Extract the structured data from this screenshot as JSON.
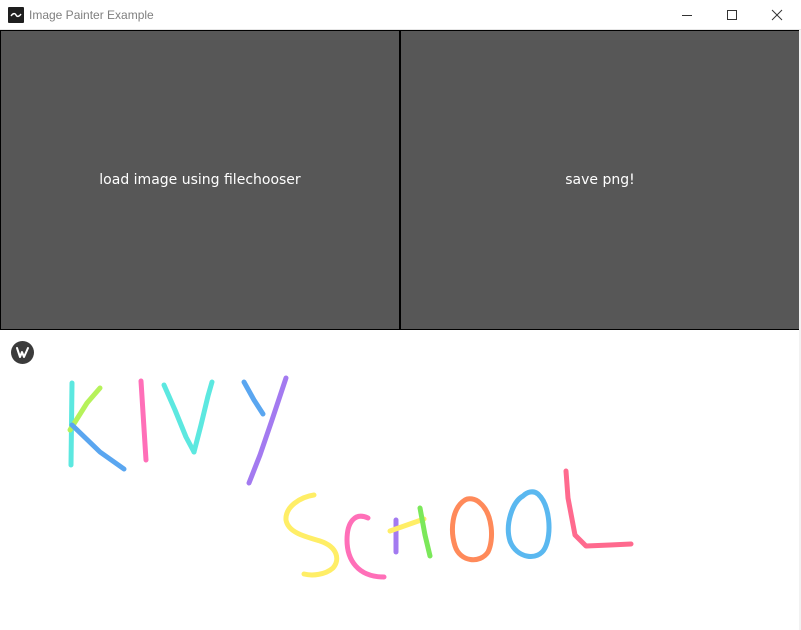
{
  "window": {
    "title": "Image Painter Example"
  },
  "buttons": {
    "load_label": "load image using filechooser",
    "save_label": "save png!"
  },
  "colors": {
    "button_bg": "#575757",
    "button_text": "#ffffff",
    "canvas_bg": "#ffffff"
  },
  "icons": {
    "app": "kivy-app-icon",
    "minimize": "minimize-icon",
    "maximize": "maximize-icon",
    "close": "close-icon",
    "logo": "kivy-logo-icon"
  }
}
